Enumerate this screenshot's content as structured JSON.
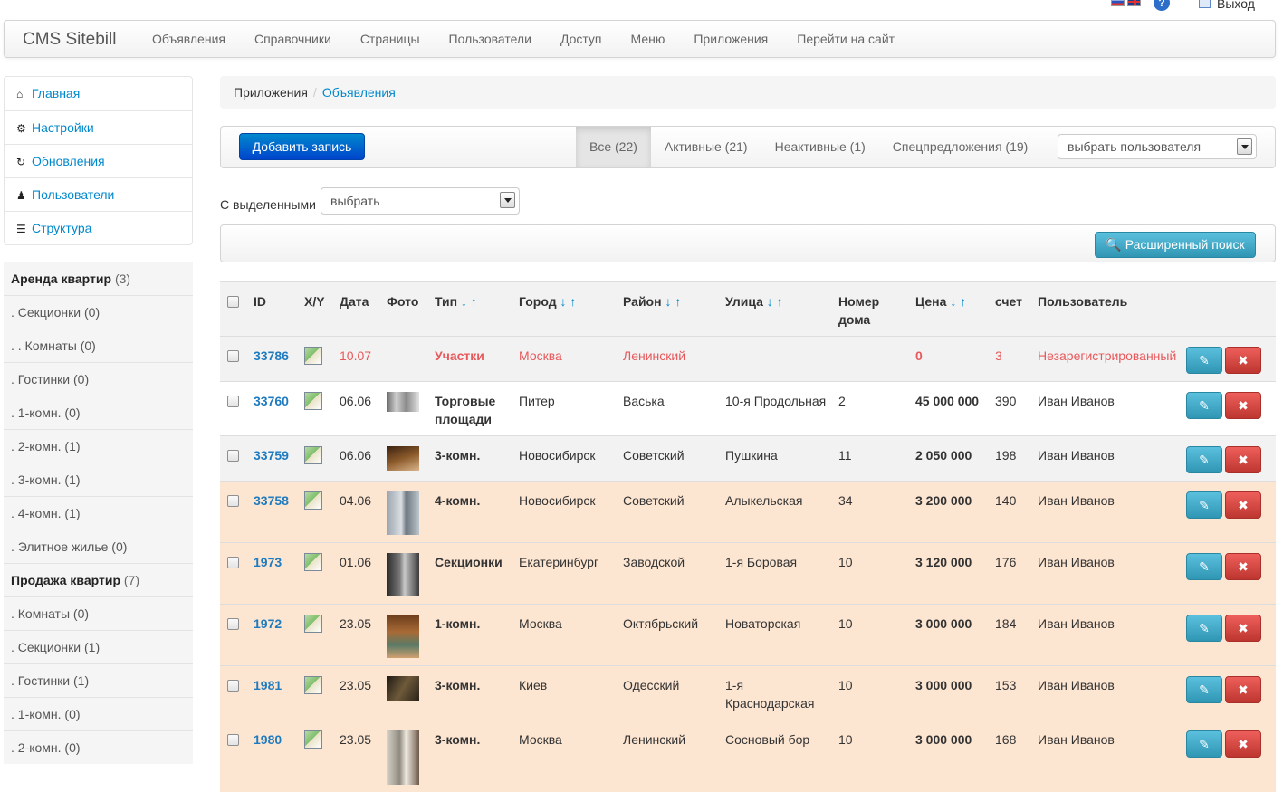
{
  "util": {
    "exit_label": "Выход",
    "help_glyph": "?"
  },
  "navbar": {
    "brand": "CMS Sitebill",
    "items": [
      "Объявления",
      "Справочники",
      "Страницы",
      "Пользователи",
      "Доступ",
      "Меню",
      "Приложения",
      "Перейти на сайт"
    ]
  },
  "sidebar": {
    "items": [
      {
        "label": "Главная",
        "icon": "home-icon"
      },
      {
        "label": "Настройки",
        "icon": "gear-icon"
      },
      {
        "label": "Обновления",
        "icon": "refresh-icon"
      },
      {
        "label": "Пользователи",
        "icon": "user-icon"
      },
      {
        "label": "Структура",
        "icon": "list-icon"
      }
    ],
    "categories": [
      {
        "label": "Аренда квартир",
        "count": "(3)",
        "head": true
      },
      {
        "label": ". Секционки (0)"
      },
      {
        "label": ". . Комнаты (0)"
      },
      {
        "label": ". Гостинки (0)"
      },
      {
        "label": ". 1-комн. (0)"
      },
      {
        "label": ". 2-комн. (1)"
      },
      {
        "label": ". 3-комн. (1)"
      },
      {
        "label": ". 4-комн. (1)"
      },
      {
        "label": ". Элитное жилье (0)"
      },
      {
        "label": "Продажа квартир",
        "count": "(7)",
        "head": true
      },
      {
        "label": ". Комнаты (0)"
      },
      {
        "label": ". Секционки (1)"
      },
      {
        "label": ". Гостинки (1)"
      },
      {
        "label": ". 1-комн. (0)"
      },
      {
        "label": ". 2-комн. (0)"
      }
    ]
  },
  "breadcrumb": {
    "parent": "Приложения",
    "separator": "/",
    "current": "Объявления"
  },
  "toolbar": {
    "add_label": "Добавить запись",
    "tabs": [
      "Все (22)",
      "Активные (21)",
      "Неактивные (1)",
      "Спецпредложения (19)"
    ],
    "active_tab": 0,
    "user_select": "выбрать пользователя"
  },
  "bulk": {
    "label": "С выделенными",
    "select": "выбрать"
  },
  "search": {
    "advanced_label": "Расширенный поиск"
  },
  "table": {
    "columns": [
      "ID",
      "X/Y",
      "Дата",
      "Фото",
      "Тип",
      "Город",
      "Район",
      "Улица",
      "Номер дома",
      "Цена",
      "счет",
      "Пользователь"
    ],
    "sort_arrows": "↓ ↑",
    "rows": [
      {
        "id": "33786",
        "date": "10.07",
        "photo": "",
        "type": "Участки",
        "city": "Москва",
        "district": "Ленинский",
        "street": "",
        "house": "",
        "price": "0",
        "count": "3",
        "user": "Незарегистрированный",
        "style": "gray",
        "highlight": "red"
      },
      {
        "id": "33760",
        "date": "06.06",
        "photo": "facade",
        "type": "Торговые площади",
        "city": "Питер",
        "district": "Васька",
        "street": "10-я Продольная",
        "house": "2",
        "price": "45 000 000",
        "count": "390",
        "user": "Иван Иванов",
        "style": "white"
      },
      {
        "id": "33759",
        "date": "06.06",
        "photo": "room",
        "type": "3-комн.",
        "city": "Новосибирск",
        "district": "Советский",
        "street": "Пушкина",
        "house": "11",
        "price": "2 050 000",
        "count": "198",
        "user": "Иван Иванов",
        "style": "gray"
      },
      {
        "id": "33758",
        "date": "04.06",
        "photo": "tower",
        "type": "4-комн.",
        "city": "Новосибирск",
        "district": "Советский",
        "street": "Алыкельская",
        "house": "34",
        "price": "3 200 000",
        "count": "140",
        "user": "Иван Иванов",
        "style": "peach"
      },
      {
        "id": "1973",
        "date": "01.06",
        "photo": "corridor",
        "type": "Секционки",
        "city": "Екатеринбург",
        "district": "Заводской",
        "street": "1-я Боровая",
        "house": "10",
        "price": "3 120 000",
        "count": "176",
        "user": "Иван Иванов",
        "style": "peach"
      },
      {
        "id": "1972",
        "date": "23.05",
        "photo": "kitchen",
        "type": "1-комн.",
        "city": "Москва",
        "district": "Октябрьский",
        "street": "Новаторская",
        "house": "10",
        "price": "3 000 000",
        "count": "184",
        "user": "Иван Иванов",
        "style": "peach"
      },
      {
        "id": "1981",
        "date": "23.05",
        "photo": "interior",
        "type": "3-комн.",
        "city": "Киев",
        "district": "Одесский",
        "street": "1-я Краснодарская",
        "house": "10",
        "price": "3 000 000",
        "count": "153",
        "user": "Иван Иванов",
        "style": "peach"
      },
      {
        "id": "1980",
        "date": "23.05",
        "photo": "hall",
        "type": "3-комн.",
        "city": "Москва",
        "district": "Ленинский",
        "street": "Сосновый бор",
        "house": "10",
        "price": "3 000 000",
        "count": "168",
        "user": "Иван Иванов",
        "style": "peach"
      }
    ],
    "edit_icon": "pencil-icon",
    "delete_icon": "remove-icon",
    "delete_glyph": "✖",
    "edit_glyph": "✎"
  },
  "colors": {
    "link": "#0088cc",
    "primary": "#0044cc",
    "info": "#2f96b4",
    "danger": "#bd362f",
    "peach_row": "#fce5d1",
    "red_text": "#e8585b"
  }
}
